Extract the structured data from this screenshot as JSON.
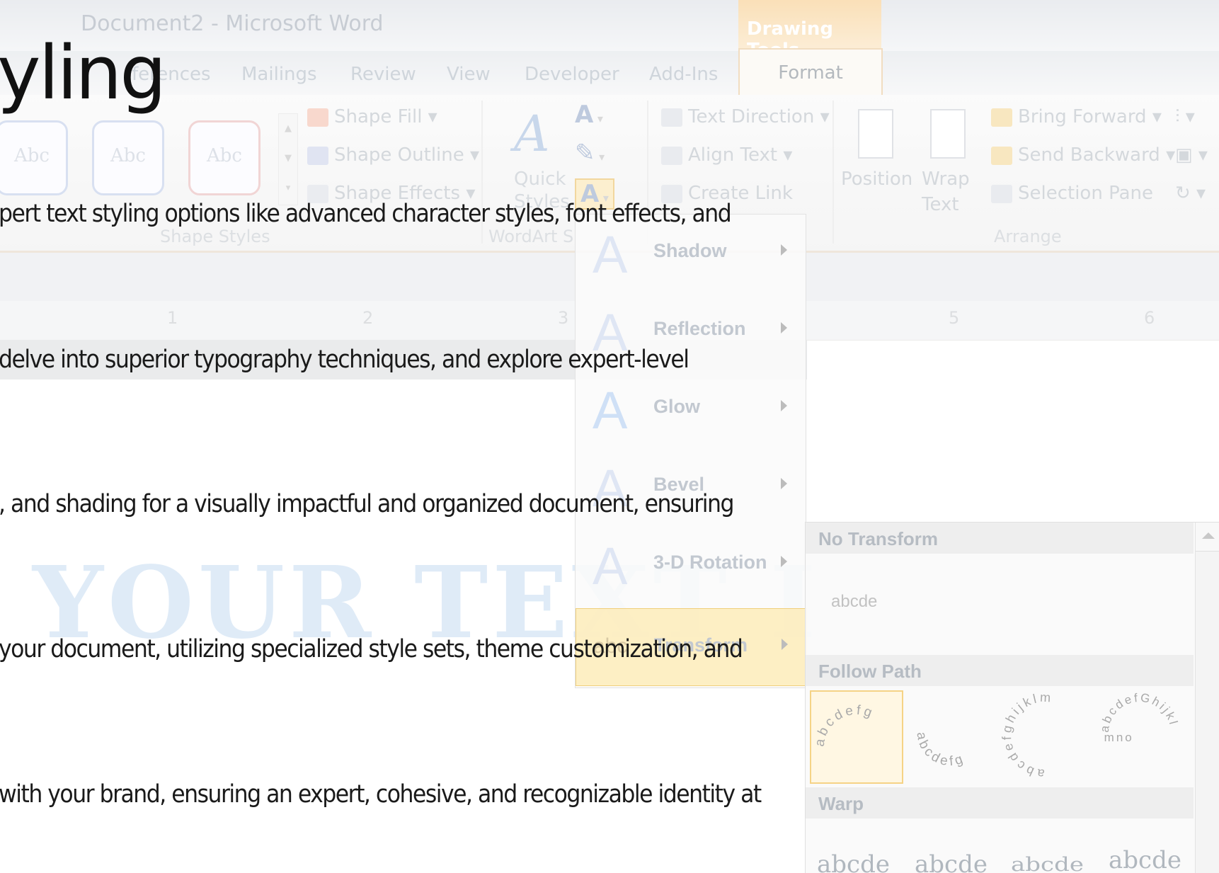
{
  "window": {
    "title": "Document2 - Microsoft Word"
  },
  "contextual_tab": {
    "header": "Drawing Tools"
  },
  "tabs": [
    "ferences",
    "Mailings",
    "Review",
    "View",
    "Developer",
    "Add-Ins",
    "Format"
  ],
  "shape_styles": {
    "thumbnails": [
      "Abc",
      "Abc",
      "Abc"
    ],
    "fill": "Shape Fill",
    "outline": "Shape Outline",
    "effects": "Shape Effects",
    "group_label": "Shape Styles"
  },
  "wordart": {
    "quick_styles": "Quick",
    "quick_styles_2": "Styles",
    "group_label": "WordArt S"
  },
  "text_group": {
    "direction": "Text Direction",
    "align": "Align Text",
    "create_link": "Create Link"
  },
  "arrange": {
    "position": "Position",
    "wrap": "Wrap",
    "wrap_2": "Text",
    "bring_forward": "Bring Forward",
    "send_backward": "Send Backward",
    "selection_pane": "Selection Pane",
    "group_label": "Arrange"
  },
  "ruler": [
    "1",
    "2",
    "3",
    "5",
    "6"
  ],
  "watermark": "YOUR TEXT I",
  "effects_menu": [
    {
      "label": "Shadow"
    },
    {
      "label": "Reflection"
    },
    {
      "label": "Glow"
    },
    {
      "label": "Bevel"
    },
    {
      "label": "3-D Rotation"
    },
    {
      "label": "Transform"
    }
  ],
  "transform_gallery": {
    "no_transform": "No Transform",
    "sample": "abcde",
    "follow_path": "Follow Path",
    "warp": "Warp",
    "warp_samples": [
      "abcde",
      "abcde",
      "abcde",
      "abcde"
    ],
    "path_thumbs": [
      {
        "name": "arch-up",
        "text": "abcdefg"
      },
      {
        "name": "arch-down",
        "text": "abcdefg"
      },
      {
        "name": "circle",
        "text": "abcdefghijklm"
      },
      {
        "name": "button",
        "text": "abcdefGhijklmno"
      }
    ]
  },
  "slide": {
    "title": "yling",
    "bullets": [
      "pert text styling options like advanced character styles, font effects, and",
      " delve into superior typography techniques, and explore expert-level",
      ", and shading for a visually impactful and organized document, ensuring",
      "your document, utilizing specialized style sets, theme customization, and",
      "with your brand, ensuring an expert, cohesive, and recognizable identity at"
    ]
  }
}
